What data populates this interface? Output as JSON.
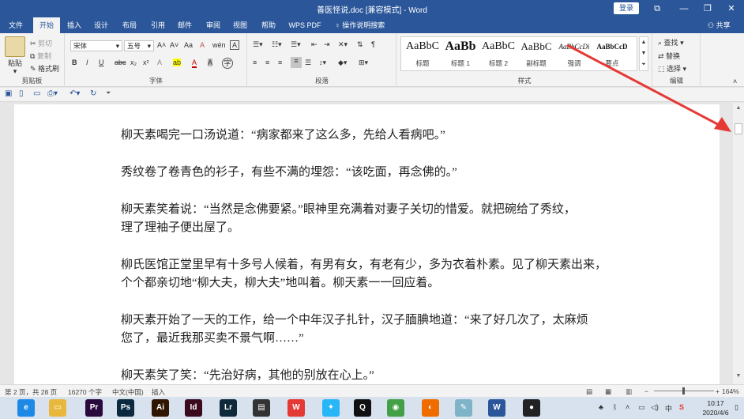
{
  "window": {
    "title": "善医怪说.doc [兼容模式] - Word",
    "login_label": "登录",
    "controls": {
      "ribbon_display": "⧉",
      "minimize": "—",
      "maximize": "❐",
      "close": "✕"
    }
  },
  "tabs": [
    {
      "label": "文件"
    },
    {
      "label": "开始"
    },
    {
      "label": "插入"
    },
    {
      "label": "设计"
    },
    {
      "label": "布局"
    },
    {
      "label": "引用"
    },
    {
      "label": "邮件"
    },
    {
      "label": "审阅"
    },
    {
      "label": "视图"
    },
    {
      "label": "帮助"
    },
    {
      "label": "WPS PDF"
    }
  ],
  "tell_me": "操作说明搜索",
  "share_label": "共享",
  "ribbon": {
    "clipboard": {
      "paste": "粘贴",
      "cut": "剪切",
      "copy": "复制",
      "format_painter": "格式刷",
      "label": "剪贴板"
    },
    "font": {
      "family": "宋体",
      "size": "五号",
      "label": "字体",
      "grow": "A˄",
      "shrink": "A˅",
      "case": "Aa",
      "clear": "A",
      "phonetic": "wén",
      "border": "A",
      "bold": "B",
      "italic": "I",
      "underline": "U",
      "strike": "abc",
      "sub": "x₂",
      "sup": "x²",
      "effects": "A",
      "highlight": "ab",
      "color": "A",
      "shade": "A",
      "enclose": "字"
    },
    "paragraph": {
      "label": "段落"
    },
    "styles": {
      "label": "样式",
      "items": [
        {
          "preview": "AaBbC",
          "name": "标题"
        },
        {
          "preview": "AaBb",
          "name": "标题 1"
        },
        {
          "preview": "AaBbC",
          "name": "标题 2"
        },
        {
          "preview": "AaBbC",
          "name": "副标题"
        },
        {
          "preview": "AaBbCcDi",
          "name": "强调"
        },
        {
          "preview": "AaBbCcD",
          "name": "要点"
        }
      ]
    },
    "editing": {
      "find": "查找",
      "replace": "替换",
      "select": "选择",
      "label": "编辑"
    }
  },
  "document": {
    "paragraphs": [
      [
        "柳天素喝完一口汤说道：“病家都来了这么多，先给人看病吧。”"
      ],
      [
        "秀纹卷了卷青色的衫子，有些不满的埋怨：“该吃面，再念佛的。”"
      ],
      [
        "柳天素笑着说：“当然是念佛要紧。”眼神里充满着对妻子关切的惜爱。就把碗给了秀纹，",
        "理了理袖子便出屋了。"
      ],
      [
        "柳氏医馆正堂里早有十多号人候着，有男有女，有老有少，多为衣着朴素。见了柳天素出来，",
        "个个都亲切地“柳大夫，柳大夫”地叫着。柳天素一一回应着。"
      ],
      [
        "柳天素开始了一天的工作，给一个中年汉子扎针，汉子腼腆地道：“来了好几次了，太麻烦",
        "您了，最近我那买卖不景气啊……”"
      ],
      [
        "柳天素笑了笑：“先治好病，其他的别放在心上。”"
      ]
    ]
  },
  "status": {
    "page": "第 2 页，共 28 页",
    "words": "16270 个字",
    "language": "中文(中国)",
    "mode": "插入",
    "zoom": "164%"
  },
  "taskbar": {
    "apps": [
      {
        "name": "browser",
        "glyph": "e",
        "color": "#1e88e5"
      },
      {
        "name": "explorer",
        "glyph": "▭",
        "color": "#e8b83c"
      },
      {
        "name": "premiere",
        "glyph": "Pr",
        "color": "#2a0a3d"
      },
      {
        "name": "photoshop",
        "glyph": "Ps",
        "color": "#0b2a3f"
      },
      {
        "name": "illustrator",
        "glyph": "Ai",
        "color": "#2f1502"
      },
      {
        "name": "indesign",
        "glyph": "Id",
        "color": "#3b0a1e"
      },
      {
        "name": "lightroom",
        "glyph": "Lr",
        "color": "#0f2a3a"
      },
      {
        "name": "video",
        "glyph": "▤",
        "color": "#333"
      },
      {
        "name": "wps",
        "glyph": "W",
        "color": "#e53935"
      },
      {
        "name": "bird",
        "glyph": "✦",
        "color": "#29b6f6"
      },
      {
        "name": "qq",
        "glyph": "Q",
        "color": "#111"
      },
      {
        "name": "chrome",
        "glyph": "◉",
        "color": "#43a047"
      },
      {
        "name": "firefox",
        "glyph": "◐",
        "color": "#ef6c00"
      },
      {
        "name": "notes",
        "glyph": "✎",
        "color": "#7fb3c8"
      },
      {
        "name": "word",
        "glyph": "W",
        "color": "#2b579a"
      },
      {
        "name": "avatar",
        "glyph": "●",
        "color": "#222"
      }
    ],
    "time": "10:17",
    "date": "2020/4/6"
  },
  "colors": {
    "accent": "#2b579a",
    "arrow": "#e53935"
  }
}
